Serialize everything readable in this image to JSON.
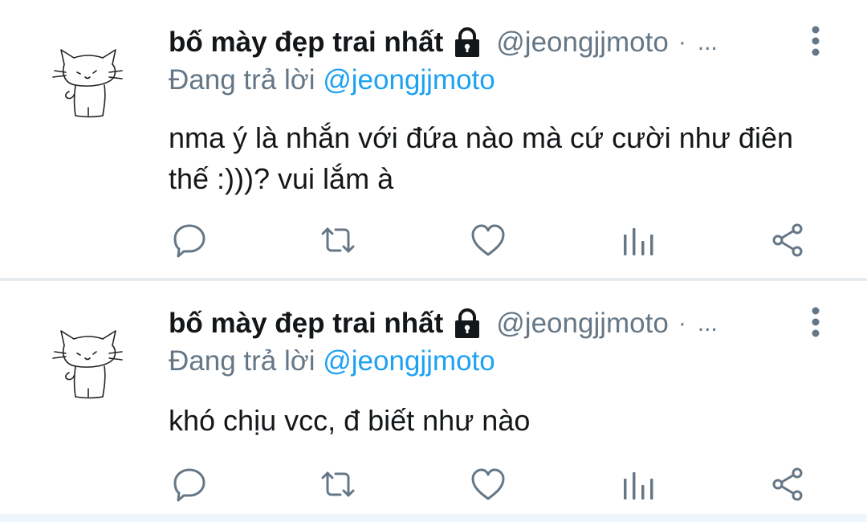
{
  "tweets": [
    {
      "display_name": "bố mày đẹp trai nhất",
      "handle": "@jeongjjmoto",
      "separator": "·",
      "truncation": "...",
      "reply_prefix": "Đang trả lời",
      "reply_to": "@jeongjjmoto",
      "text": "nma ý là nhắn với đứa nào mà cứ cười như điên thế :)))? vui lắm à",
      "avatar": "cat-sketch-avatar",
      "locked": true
    },
    {
      "display_name": "bố mày đẹp trai nhất",
      "handle": "@jeongjjmoto",
      "separator": "·",
      "truncation": "...",
      "reply_prefix": "Đang trả lời",
      "reply_to": "@jeongjjmoto",
      "text": "khó chịu vcc, đ biết như nào",
      "avatar": "cat-sketch-avatar",
      "locked": true
    }
  ],
  "actions": [
    "reply-icon",
    "retweet-icon",
    "like-icon",
    "analytics-icon",
    "share-icon"
  ],
  "colors": {
    "text": "#14171a",
    "secondary": "#657786",
    "accent": "#1da1f2",
    "icon": "#657786",
    "divider": "#e6ecf0"
  }
}
